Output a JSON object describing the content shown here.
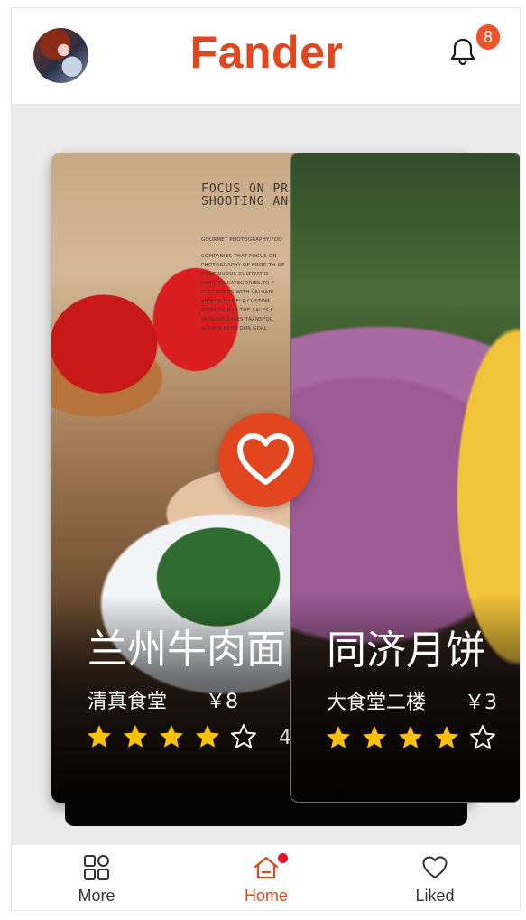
{
  "header": {
    "brand": "Fander",
    "notification_count": "8"
  },
  "cards": [
    {
      "title": "兰州牛肉面",
      "location": "清真食堂",
      "price": "￥8",
      "rating_stars": 4,
      "rating_max": 5,
      "rating_text": "4",
      "photo_text_heading": "FOCUS ON PR\nSHOOTING AND",
      "photo_text_sub": "GOURMET PHOTOGRAPHY/FOO",
      "photo_text_body": "COMPANIES THAT FOCUS ON PHOTOGRAPHY OF FOOD,TH OF CONTINUOUS CULTIVATIO FAMILIAR CATEGORIES,TO P CUSTOMERS WITH VALUABL VIDEOS,TO HELP CUSTOM ATTENTION IN THE SALES C IMPROVE SALES TRANSFOR ALWAYS BEEN OUR GOAL"
    },
    {
      "title": "同济月饼",
      "location": "大食堂二楼",
      "price": "￥3",
      "rating_stars": 4,
      "rating_max": 5
    }
  ],
  "colors": {
    "accent": "#e2461e",
    "star_filled": "#ffc107",
    "badge": "#f0532c",
    "nav_dot": "#e8112a"
  },
  "nav": {
    "items": [
      {
        "label": "More",
        "icon": "grid-icon"
      },
      {
        "label": "Home",
        "icon": "home-icon",
        "active": true
      },
      {
        "label": "Liked",
        "icon": "heart-outline-icon"
      }
    ]
  }
}
